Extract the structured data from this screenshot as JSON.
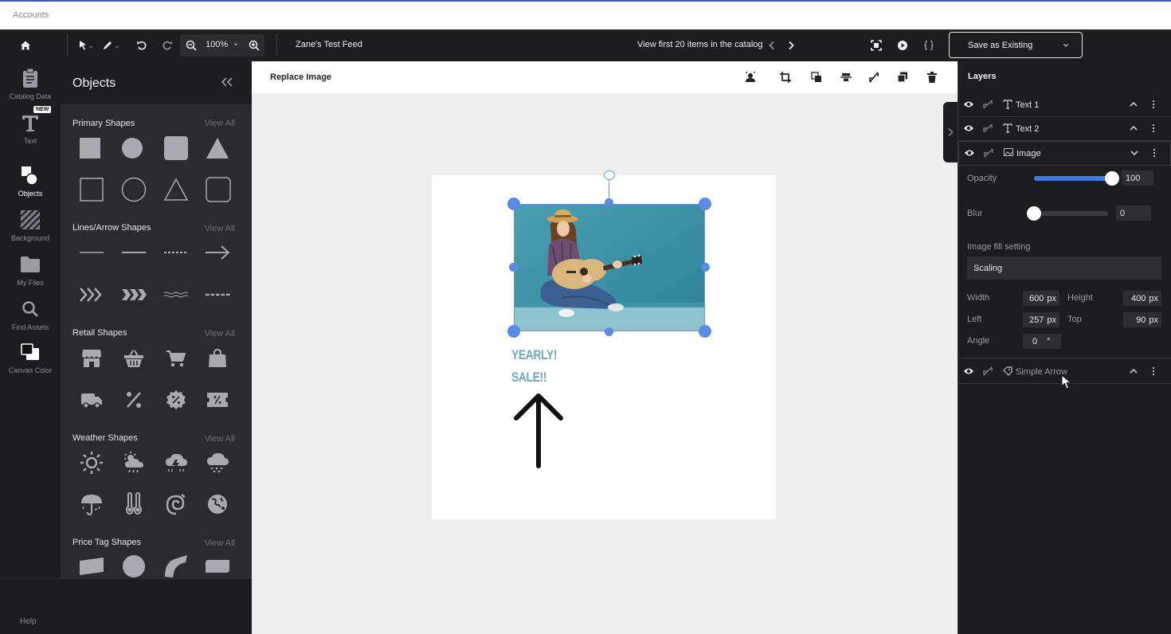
{
  "accounts_bar": {
    "label": "Accounts"
  },
  "toolbar": {
    "zoom": "100%",
    "feed_name": "Zane's Test Feed",
    "catalog_nav": "View first 20 items in the catalog",
    "save_label": "Save as Existing"
  },
  "left_rail": {
    "items": [
      {
        "label": "Catalog Data",
        "icon": "clipboard-icon"
      },
      {
        "label": "Text",
        "icon": "text-icon",
        "badge": "NEW"
      },
      {
        "label": "Objects",
        "icon": "shapes-icon"
      },
      {
        "label": "Background",
        "icon": "stripes-icon"
      },
      {
        "label": "My Files",
        "icon": "folder-icon"
      },
      {
        "label": "Find Assets",
        "icon": "search-icon"
      },
      {
        "label": "Canvas Color",
        "icon": "color-swatch-icon"
      }
    ],
    "help": "Help"
  },
  "objects_panel": {
    "title": "Objects",
    "view_all": "View All",
    "sections": [
      {
        "title": "Primary Shapes"
      },
      {
        "title": "Lines/Arrow Shapes"
      },
      {
        "title": "Retail Shapes"
      },
      {
        "title": "Weather Shapes"
      },
      {
        "title": "Price Tag Shapes"
      }
    ]
  },
  "canvas": {
    "context_label": "Replace Image",
    "text_line1": "YEARLY!",
    "text_line2": "SALE!!"
  },
  "layers_panel": {
    "title": "Layers",
    "layers": [
      {
        "name": "Text 1",
        "type": "text"
      },
      {
        "name": "Text 2",
        "type": "text"
      },
      {
        "name": "Image",
        "type": "image",
        "selected": true
      },
      {
        "name": "Simple Arrow",
        "type": "shape"
      }
    ],
    "properties": {
      "opacity_label": "Opacity",
      "opacity_value": "100",
      "opacity_fraction": 1.0,
      "blur_label": "Blur",
      "blur_value": "0",
      "blur_fraction": 0.0,
      "fill_label": "Image fill setting",
      "fill_value": "Scaling",
      "width_label": "Width",
      "width_value": "600",
      "height_label": "Height",
      "height_value": "400",
      "left_label": "Left",
      "left_value": "257",
      "top_label": "Top",
      "top_value": "90",
      "angle_label": "Angle",
      "angle_value": "0",
      "px_unit": "px",
      "degree_unit": "°"
    }
  },
  "colors": {
    "accent": "#3f7ae0",
    "selection": "#5b8be6",
    "dark_bg": "#1d1d1f",
    "panel_bg": "#2b2b2e",
    "sale_text": "#6aa8c6"
  }
}
